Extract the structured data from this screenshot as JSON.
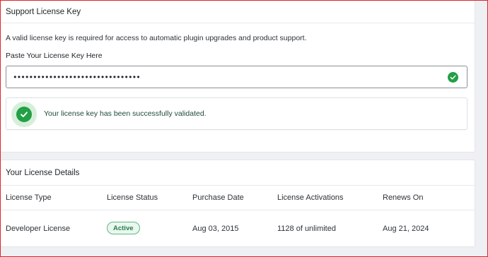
{
  "support": {
    "title": "Support License Key",
    "description": "A valid license key is required for access to automatic plugin upgrades and product support.",
    "field_label": "Paste Your License Key Here",
    "license_key_value": "••••••••••••••••••••••••••••••••",
    "success_message": "Your license key has been successfully validated."
  },
  "details": {
    "title": "Your License Details",
    "columns": [
      "License Type",
      "License Status",
      "Purchase Date",
      "License Activations",
      "Renews On"
    ],
    "row": {
      "license_type": "Developer License",
      "license_status": "Active",
      "purchase_date": "Aug 03, 2015",
      "activations": "1128 of unlimited",
      "renews_on": "Aug 21, 2024"
    }
  },
  "icons": {
    "input_status": "check-circle-icon",
    "notice_status": "check-circle-icon"
  },
  "colors": {
    "success_green": "#22a045",
    "success_bg": "#d7eedb",
    "badge_text": "#23804b",
    "frame_border": "#e0252b"
  }
}
